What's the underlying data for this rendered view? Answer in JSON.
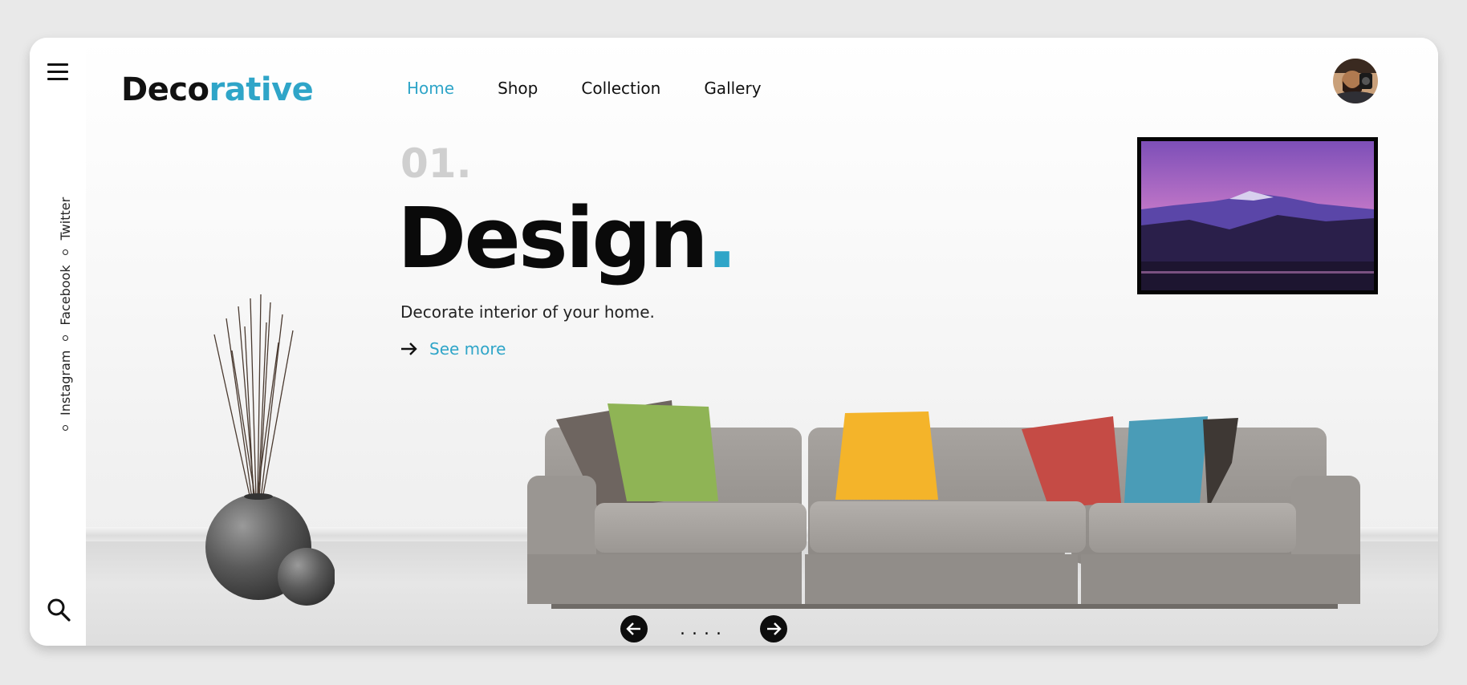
{
  "brand": {
    "logo_part1": "Deco",
    "logo_part2": "rative",
    "accent_color": "#2fa5c8"
  },
  "nav": {
    "items": [
      {
        "label": "Home",
        "active": true
      },
      {
        "label": "Shop",
        "active": false
      },
      {
        "label": "Collection",
        "active": false
      },
      {
        "label": "Gallery",
        "active": false
      }
    ]
  },
  "sidebar": {
    "menu_icon": "hamburger-icon",
    "social": [
      "Instagram",
      "Facebook",
      "Twitter"
    ],
    "search_icon": "search-icon"
  },
  "hero": {
    "number": "01.",
    "title": "Design",
    "title_dot": ".",
    "subtitle": "Decorate interior of your home.",
    "cta": "See more",
    "cta_icon": "arrow-right-icon"
  },
  "slider": {
    "prev_icon": "arrow-left-icon",
    "next_icon": "arrow-right-icon",
    "dots": "...."
  },
  "user": {
    "avatar_icon": "avatar"
  }
}
